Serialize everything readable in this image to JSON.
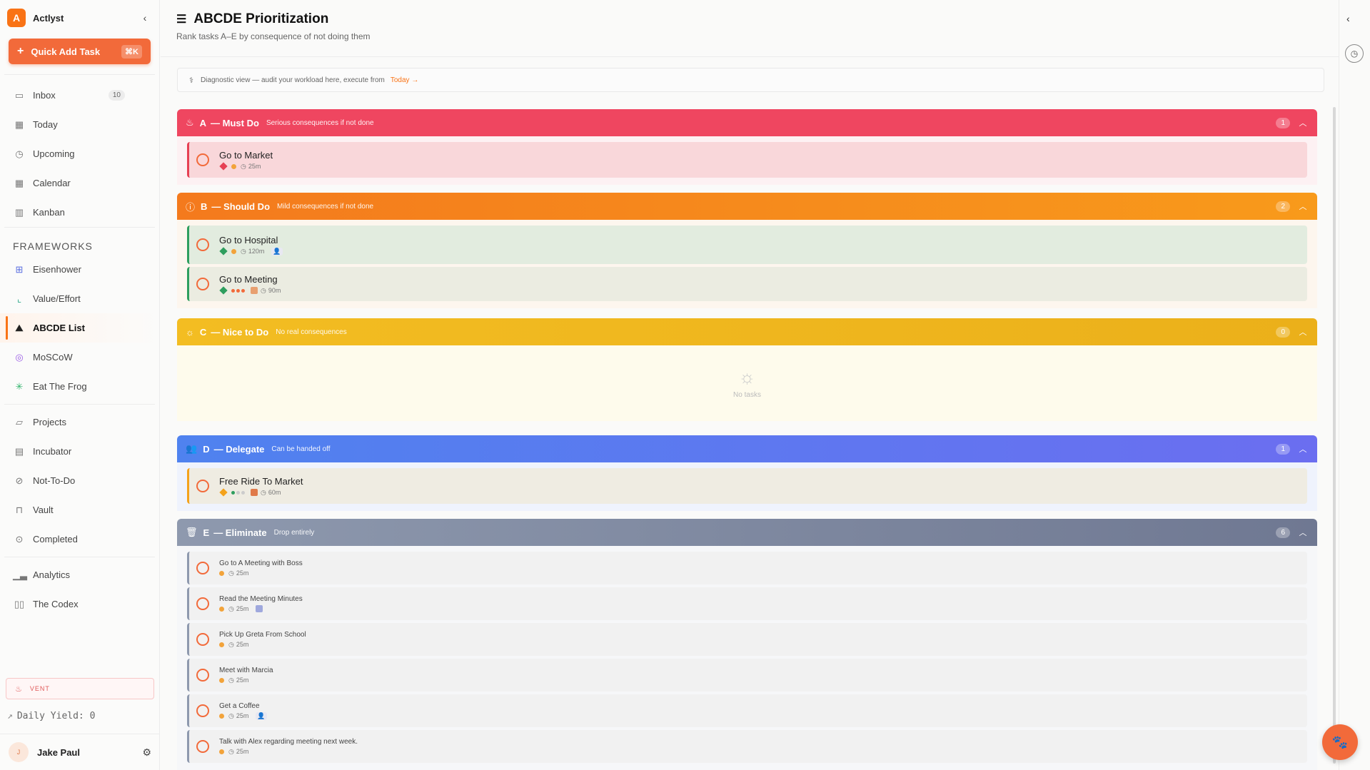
{
  "app": {
    "logo_letter": "A",
    "name": "Actlyst",
    "collapse_icon": "chevron-left-icon"
  },
  "quick_add": {
    "label": "Quick Add Task",
    "shortcut": "⌘K"
  },
  "nav": [
    {
      "label": "Inbox",
      "icon": "inbox-icon",
      "badge": "10"
    },
    {
      "label": "Today",
      "icon": "calendar-icon"
    },
    {
      "label": "Upcoming",
      "icon": "calendar-clock-icon"
    },
    {
      "label": "Calendar",
      "icon": "calendar-grid-icon"
    },
    {
      "label": "Kanban",
      "icon": "kanban-icon"
    }
  ],
  "frameworks_label": "FRAMEWORKS",
  "frameworks": [
    {
      "label": "Eisenhower",
      "icon": "grid-icon"
    },
    {
      "label": "Value/Effort",
      "icon": "scatter-chart-icon"
    },
    {
      "label": "ABCDE List",
      "icon": "mountain-icon",
      "active": true
    },
    {
      "label": "MoSCoW",
      "icon": "target-icon"
    },
    {
      "label": "Eat The Frog",
      "icon": "bug-icon"
    }
  ],
  "other_nav": [
    {
      "label": "Projects",
      "icon": "folder-icon"
    },
    {
      "label": "Incubator",
      "icon": "archive-icon"
    },
    {
      "label": "Not-To-Do",
      "icon": "ban-icon"
    },
    {
      "label": "Vault",
      "icon": "lock-icon"
    },
    {
      "label": "Completed",
      "icon": "check-circle-icon"
    }
  ],
  "bottom_nav": [
    {
      "label": "Analytics",
      "icon": "bar-chart-icon"
    },
    {
      "label": "The Codex",
      "icon": "book-icon"
    }
  ],
  "vent": {
    "label": "VENT"
  },
  "daily_yield": "Daily Yield: 0",
  "user": {
    "initial": "J",
    "name": "Jake Paul"
  },
  "page": {
    "title": "ABCDE Prioritization",
    "subtitle": "Rank tasks A–E by consequence of not doing them"
  },
  "diagnostic": {
    "text": "Diagnostic view — audit your workload here, execute from",
    "link": "Today →"
  },
  "sections": {
    "a": {
      "letter": "A",
      "name": "— Must Do",
      "desc": "Serious consequences if not done",
      "count": "1",
      "color": "#ef4660",
      "tasks": [
        {
          "name": "Go to Market",
          "duration": "25m"
        }
      ]
    },
    "b": {
      "letter": "B",
      "name": "— Should Do",
      "desc": "Mild consequences if not done",
      "count": "2",
      "color": "#f7811d",
      "tasks": [
        {
          "name": "Go to Hospital",
          "duration": "120m"
        },
        {
          "name": "Go to Meeting",
          "duration": "90m"
        }
      ]
    },
    "c": {
      "letter": "C",
      "name": "— Nice to Do",
      "desc": "No real consequences",
      "count": "0",
      "color": "#f1b51d",
      "empty": "No tasks"
    },
    "d": {
      "letter": "D",
      "name": "— Delegate",
      "desc": "Can be handed off",
      "count": "1",
      "color": "#5a7df0",
      "tasks": [
        {
          "name": "Free Ride To Market",
          "duration": "60m"
        }
      ]
    },
    "e": {
      "letter": "E",
      "name": "— Eliminate",
      "desc": "Drop entirely",
      "count": "6",
      "color": "#7f8aa0",
      "tasks": [
        {
          "name": "Go to A Meeting with Boss",
          "duration": "25m"
        },
        {
          "name": "Read the Meeting Minutes",
          "duration": "25m"
        },
        {
          "name": "Pick Up Greta From School",
          "duration": "25m"
        },
        {
          "name": "Meet with Marcia",
          "duration": "25m"
        },
        {
          "name": "Get a Coffee",
          "duration": "25m"
        },
        {
          "name": "Talk with Alex regarding meeting next week.",
          "duration": "25m"
        }
      ]
    }
  }
}
